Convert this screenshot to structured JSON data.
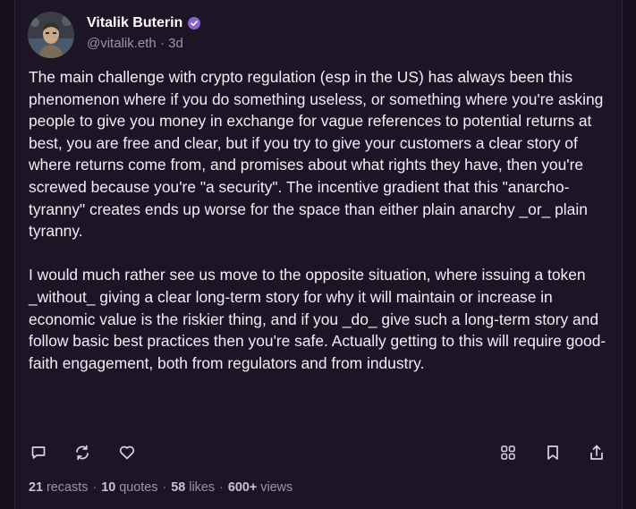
{
  "post": {
    "author": {
      "name": "Vitalik Buterin",
      "handle": "@vitalik.eth",
      "separator": "·",
      "time": "3d"
    },
    "paragraphs": [
      "The main challenge with crypto regulation (esp in the US) has always been this phenomenon where if you do something useless, or something where you're asking people to give you money in exchange for vague references to potential returns at best, you are free and clear, but if you try to give your customers a clear story of where returns come from, and promises about what rights they have, then you're screwed because you're \"a security\". The incentive gradient that this \"anarcho-tyranny\" creates ends up worse for the space than either plain anarchy _or_ plain tyranny.",
      "I would much rather see us move to the opposite situation, where issuing a token _without_ giving a clear long-term story for why it will maintain or increase in economic value is the riskier thing, and if you _do_ give such a long-term story and follow basic best practices then you're safe. Actually getting to this will require good-faith engagement, both from regulators and from industry."
    ],
    "actions": {
      "left": [
        "reply-icon",
        "recast-icon",
        "like-icon"
      ],
      "right": [
        "apps-grid-icon",
        "bookmark-icon",
        "share-icon"
      ]
    },
    "stats": {
      "recasts_count": "21",
      "recasts_label": "recasts",
      "quotes_count": "10",
      "quotes_label": "quotes",
      "likes_count": "58",
      "likes_label": "likes",
      "views_count": "600+",
      "views_label": "views",
      "separator": "·"
    }
  },
  "colors": {
    "background": "#17101f",
    "card": "#1c1526",
    "text": "#f1eef6",
    "muted": "#9c93a8",
    "verified": "#8a63d2"
  }
}
